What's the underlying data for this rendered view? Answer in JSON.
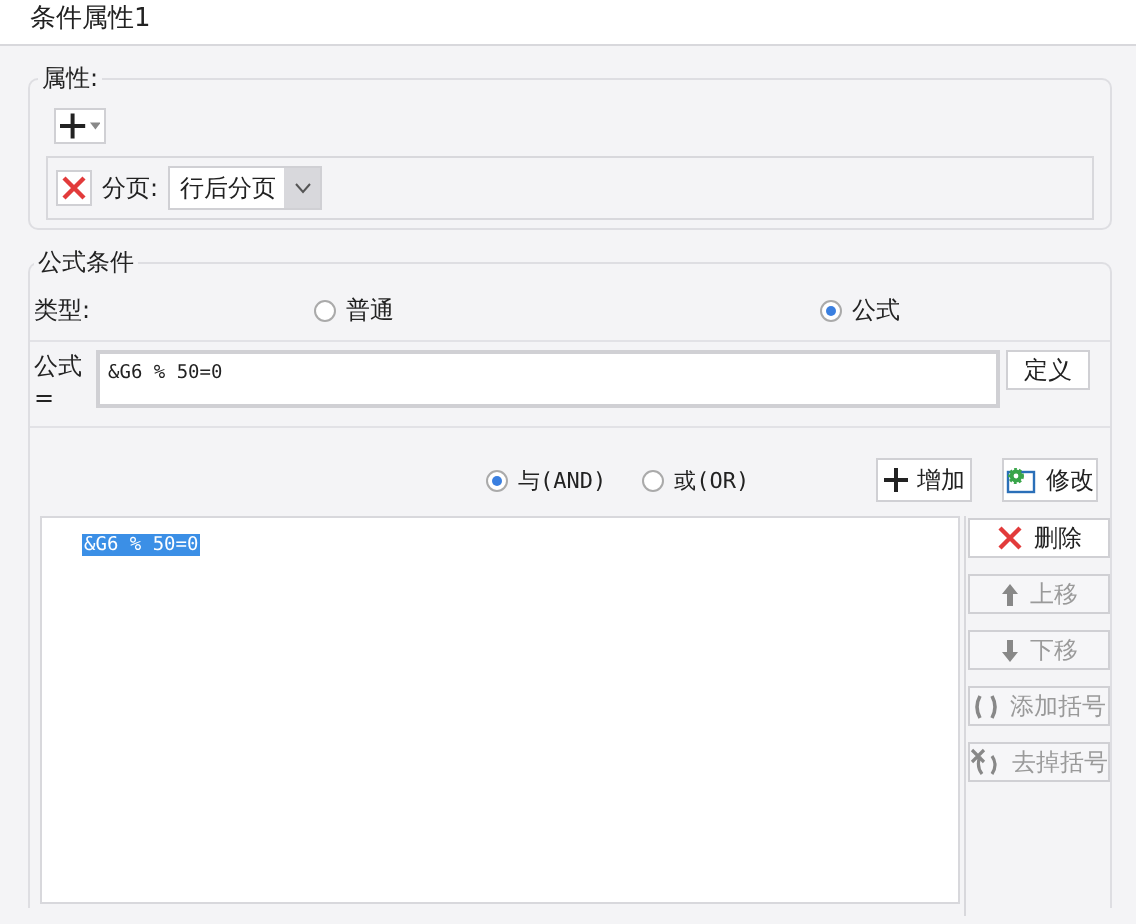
{
  "window": {
    "title": "条件属性1"
  },
  "properties": {
    "legend": "属性:",
    "items": [
      {
        "label": "分页:",
        "value": "行后分页"
      }
    ]
  },
  "formula_condition": {
    "legend": "公式条件",
    "type_label": "类型:",
    "types": [
      {
        "label": "普通",
        "selected": false
      },
      {
        "label": "公式",
        "selected": true
      }
    ],
    "formula_label": "公式=",
    "formula_value": "&G6 % 50=0",
    "define_button": "定义",
    "logic": [
      {
        "label": "与(AND)",
        "selected": true
      },
      {
        "label": "或(OR)",
        "selected": false
      }
    ],
    "add_button": "增加",
    "modify_button": "修改",
    "conditions": [
      {
        "text": "&G6 % 50=0",
        "selected": true
      }
    ],
    "actions": [
      {
        "kind": "delete",
        "label": "删除",
        "disabled": false
      },
      {
        "kind": "up",
        "label": "上移",
        "disabled": true
      },
      {
        "kind": "down",
        "label": "下移",
        "disabled": true
      },
      {
        "kind": "add-paren",
        "label": "添加括号",
        "disabled": true
      },
      {
        "kind": "remove-paren",
        "label": "去掉括号",
        "disabled": true
      }
    ]
  }
}
